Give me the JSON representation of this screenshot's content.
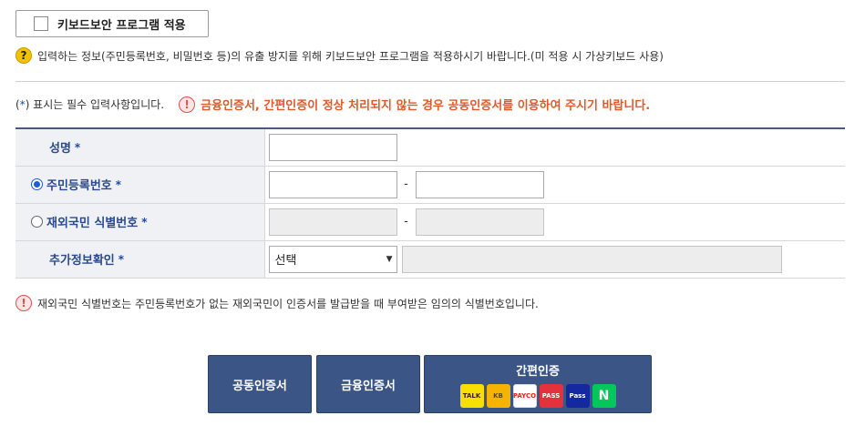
{
  "keyboard_security": {
    "label": "키보드보안 프로그램 적용",
    "checked": false
  },
  "notice_top": {
    "icon": "question-icon",
    "text": "입력하는 정보(주민등록번호, 비밀번호 등)의 유출 방지를 위해 키보드보안 프로그램을 적용하시기 바랍니다.(미 적용 시 가상키보드 사용)"
  },
  "required_note": {
    "prefix": "(",
    "star": "*",
    "suffix": ") 표시는 필수 입력사항입니다."
  },
  "warning": {
    "icon": "exclamation-icon",
    "text": "금융인증서, 간편인증이 정상 처리되지 않는 경우 공동인증서를 이용하여 주시기 바랍니다."
  },
  "form": {
    "star": "*",
    "dash": "-",
    "rows": [
      {
        "label": "성명"
      },
      {
        "label": "주민등록번호",
        "selected": true
      },
      {
        "label": "재외국민 식별번호",
        "selected": false
      },
      {
        "label": "추가정보확인",
        "select_value": "선택"
      }
    ]
  },
  "notice_bottom": {
    "icon": "exclamation-icon",
    "text": "재외국민 식별번호는 주민등록번호가 없는 재외국민이 인증서를 발급받을 때 부여받은 임의의 식별번호입니다."
  },
  "buttons": {
    "joint_cert": "공동인증서",
    "financial_cert": "금융인증서",
    "simple_auth": "간편인증",
    "logos": [
      {
        "name": "kakao-talk-logo",
        "text": "TALK"
      },
      {
        "name": "kb-logo",
        "text": "KB"
      },
      {
        "name": "payco-logo",
        "text": "PAYCO"
      },
      {
        "name": "pass-logo",
        "text": "PASS"
      },
      {
        "name": "samsung-pass-logo",
        "text": "Pass"
      },
      {
        "name": "naver-logo",
        "text": "N"
      }
    ]
  },
  "colors": {
    "accent": "#3a5586",
    "warning": "#e0592a",
    "label": "#2a4a8a"
  }
}
